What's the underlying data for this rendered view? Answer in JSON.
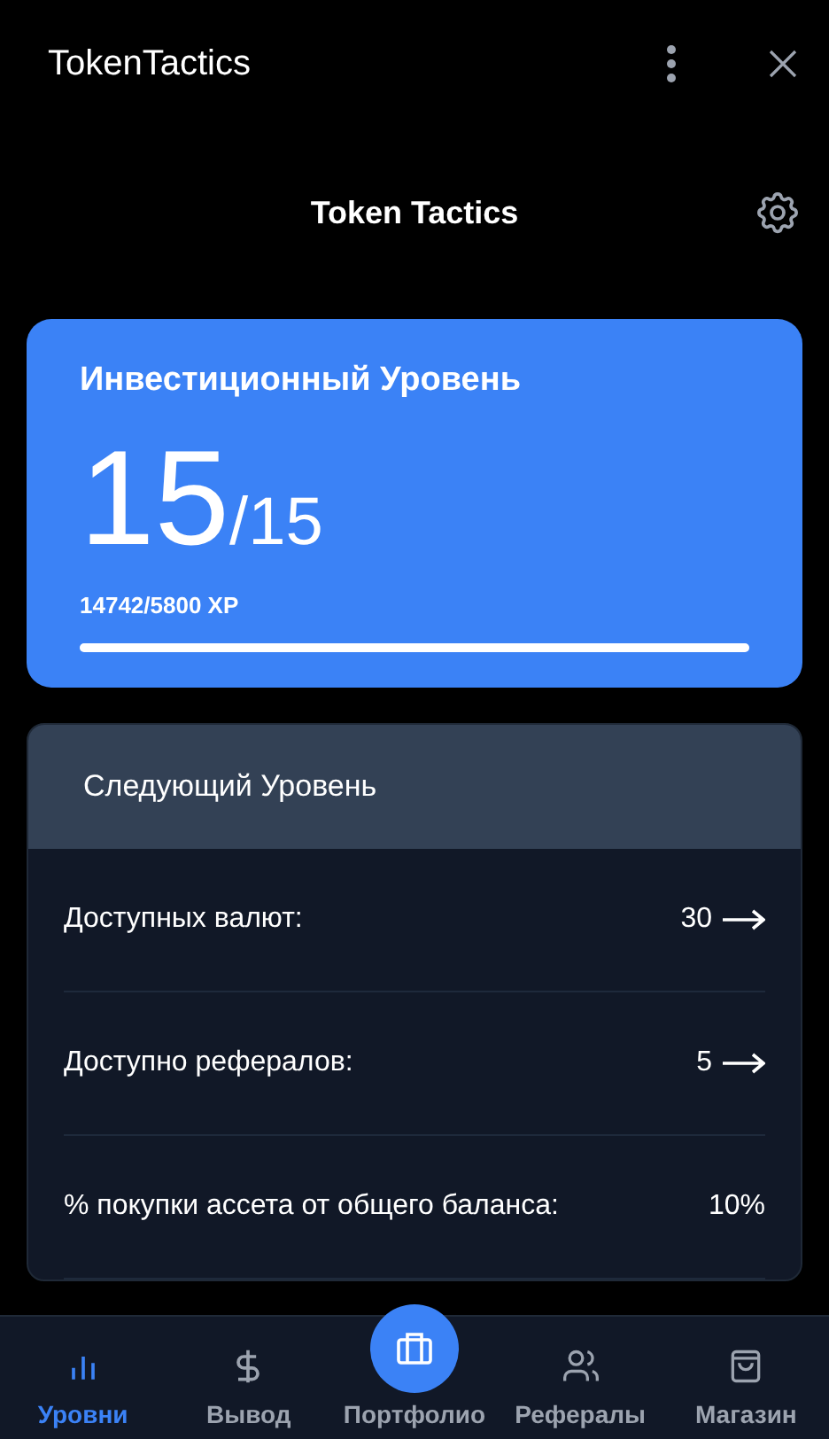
{
  "window": {
    "title": "TokenTactics"
  },
  "header": {
    "title": "Token Tactics"
  },
  "level_card": {
    "title": "Инвестиционный Уровень",
    "level": "15",
    "max": "/15",
    "xp": "14742/5800 XP",
    "progress": {
      "level": 1
    }
  },
  "next_level": {
    "title": "Следующий Уровень",
    "rows": [
      {
        "label": "Доступных валют:",
        "value": "30",
        "arrow": true
      },
      {
        "label": "Доступно рефералов:",
        "value": "5",
        "arrow": true
      },
      {
        "label": "% покупки ассета от общего баланса:",
        "value": "10%",
        "arrow": false
      }
    ]
  },
  "nav": [
    {
      "kind": "chart",
      "label": "Уровни",
      "selected": true
    },
    {
      "kind": "dollar",
      "label": "Вывод",
      "selected": false
    },
    {
      "kind": "briefcase",
      "label": "Портфолио",
      "selected": false
    },
    {
      "kind": "users",
      "label": "Рефералы",
      "selected": false
    },
    {
      "kind": "bag",
      "label": "Магазин",
      "selected": false
    }
  ]
}
